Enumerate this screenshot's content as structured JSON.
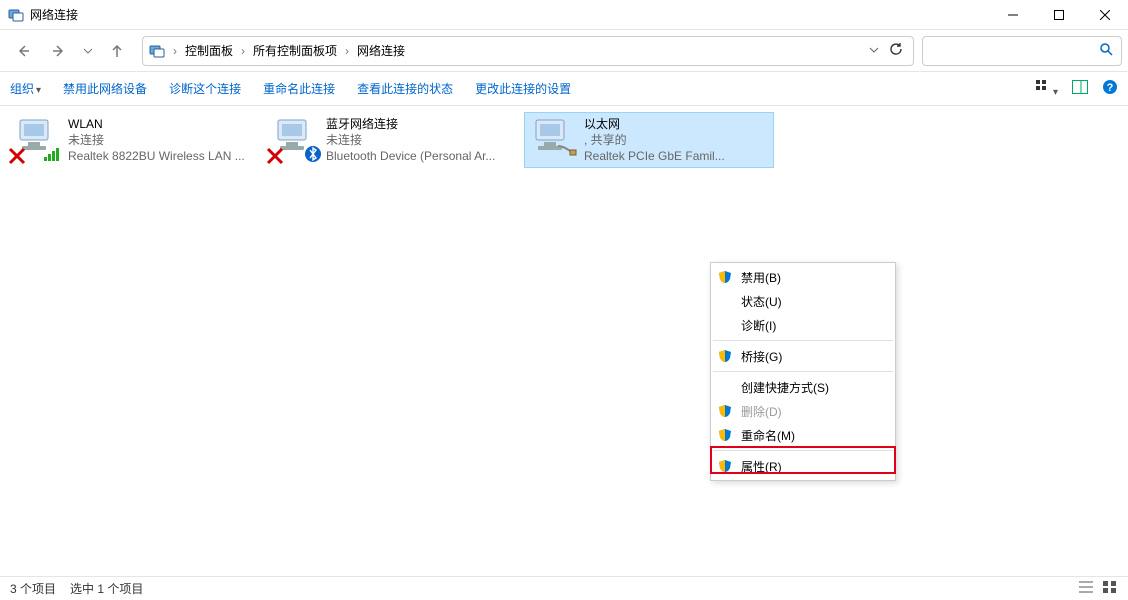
{
  "window": {
    "title": "网络连接"
  },
  "breadcrumb": {
    "items": [
      "控制面板",
      "所有控制面板项",
      "网络连接"
    ]
  },
  "toolbar": {
    "organize": "组织",
    "disable": "禁用此网络设备",
    "diagnose": "诊断这个连接",
    "rename": "重命名此连接",
    "status": "查看此连接的状态",
    "settings": "更改此连接的设置"
  },
  "connections": [
    {
      "name": "WLAN",
      "status": "未连接",
      "device": "Realtek 8822BU Wireless LAN ...",
      "badge": "x-signal"
    },
    {
      "name": "蓝牙网络连接",
      "status": "未连接",
      "device": "Bluetooth Device (Personal Ar...",
      "badge": "x-bt"
    },
    {
      "name": "以太网",
      "status": ", 共享的",
      "device": "Realtek PCIe GbE Famil...",
      "badge": "eth",
      "selected": true
    }
  ],
  "context_menu": {
    "disable": "禁用(B)",
    "status": "状态(U)",
    "diagnose": "诊断(I)",
    "bridge": "桥接(G)",
    "shortcut": "创建快捷方式(S)",
    "delete": "删除(D)",
    "rename": "重命名(M)",
    "properties": "属性(R)"
  },
  "statusbar": {
    "count": "3 个项目",
    "selected": "选中 1 个项目"
  }
}
